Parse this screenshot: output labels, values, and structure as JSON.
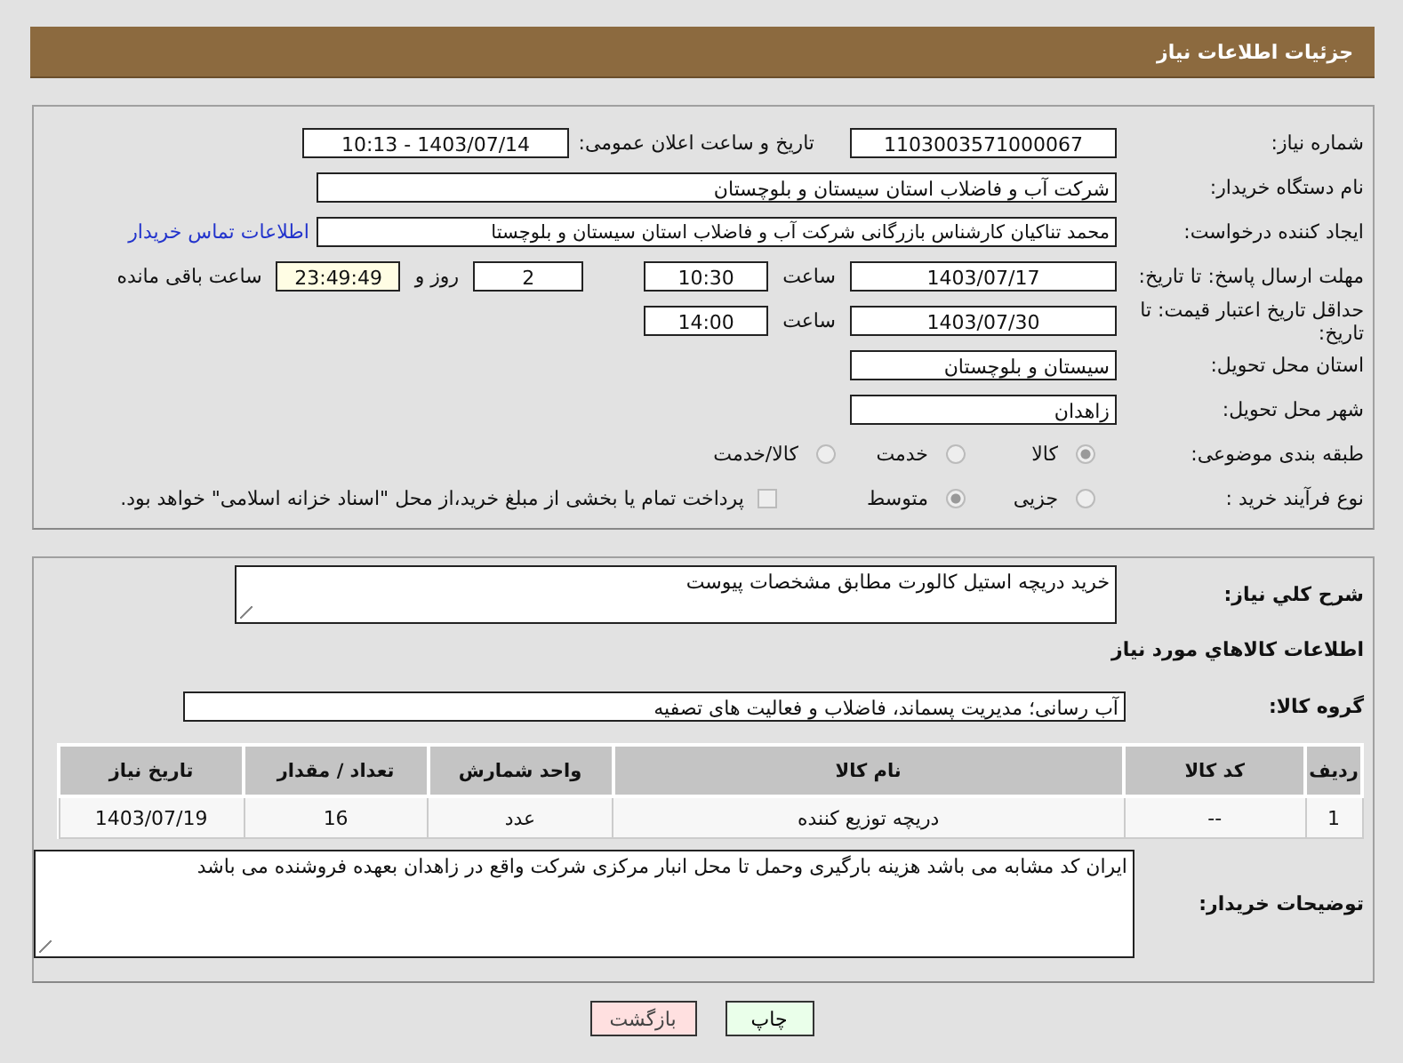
{
  "header": {
    "title": "جزئیات اطلاعات نیاز"
  },
  "details": {
    "need_number": {
      "label": "شماره نیاز:",
      "value": "1103003571000067"
    },
    "announce": {
      "label": "تاریخ و ساعت اعلان عمومی:",
      "value": "1403/07/14 - 10:13"
    },
    "buyer_org": {
      "label": "نام دستگاه خریدار:",
      "value": "شرکت آب و فاضلاب استان سیستان و بلوچستان"
    },
    "requester": {
      "label": "ایجاد کننده درخواست:",
      "value": "محمد تناکیان کارشناس بازرگانی شرکت آب و فاضلاب استان سیستان و بلوچستا",
      "link": "اطلاعات تماس خریدار"
    },
    "deadline": {
      "label": "مهلت ارسال پاسخ: تا تاریخ:",
      "date": "1403/07/17",
      "time_label": "ساعت",
      "time": "10:30",
      "days": "2",
      "days_label": "روز و",
      "remaining": "23:49:49",
      "remaining_label": "ساعت باقی مانده"
    },
    "validity": {
      "label": "حداقل تاریخ اعتبار قیمت: تا تاریخ:",
      "date": "1403/07/30",
      "time_label": "ساعت",
      "time": "14:00"
    },
    "province": {
      "label": "استان محل تحویل:",
      "value": "سیستان و بلوچستان"
    },
    "city": {
      "label": "شهر محل تحویل:",
      "value": "زاهدان"
    },
    "category": {
      "label": "طبقه بندی موضوعی:",
      "options": [
        {
          "label": "کالا",
          "selected": true
        },
        {
          "label": "خدمت",
          "selected": false
        },
        {
          "label": "کالا/خدمت",
          "selected": false
        }
      ]
    },
    "process": {
      "label": "نوع فرآیند خرید :",
      "options": [
        {
          "label": "جزیی",
          "selected": false
        },
        {
          "label": "متوسط",
          "selected": true
        }
      ],
      "payment": {
        "checked": false,
        "text": "پرداخت تمام یا بخشی از مبلغ خرید،از محل \"اسناد خزانه اسلامی\" خواهد بود."
      }
    }
  },
  "needs": {
    "summary": {
      "label": "شرح کلي نياز:",
      "value": "خرید دریچه استیل کالورت مطابق مشخصات پیوست"
    },
    "goods_heading": "اطلاعات کالاهاي مورد نياز",
    "goods_group": {
      "label": "گروه کالا:",
      "value": "آب رسانی؛ مدیریت پسماند، فاضلاب و فعالیت های تصفیه"
    },
    "table": {
      "columns": [
        "ردیف",
        "کد کالا",
        "نام کالا",
        "واحد شمارش",
        "تعداد / مقدار",
        "تاریخ نیاز"
      ],
      "rows": [
        [
          "1",
          "--",
          "دریچه توزیع کننده",
          "عدد",
          "16",
          "1403/07/19"
        ]
      ]
    },
    "notes": {
      "label": "توضیحات خریدار:",
      "value": "ایران کد مشابه می باشد هزینه بارگیری وحمل  تا محل انبار مرکزی شرکت واقع در زاهدان بعهده فروشنده می باشد"
    }
  },
  "buttons": [
    {
      "label": "چاپ",
      "kind": "print"
    },
    {
      "label": "بازگشت",
      "kind": "back"
    }
  ]
}
